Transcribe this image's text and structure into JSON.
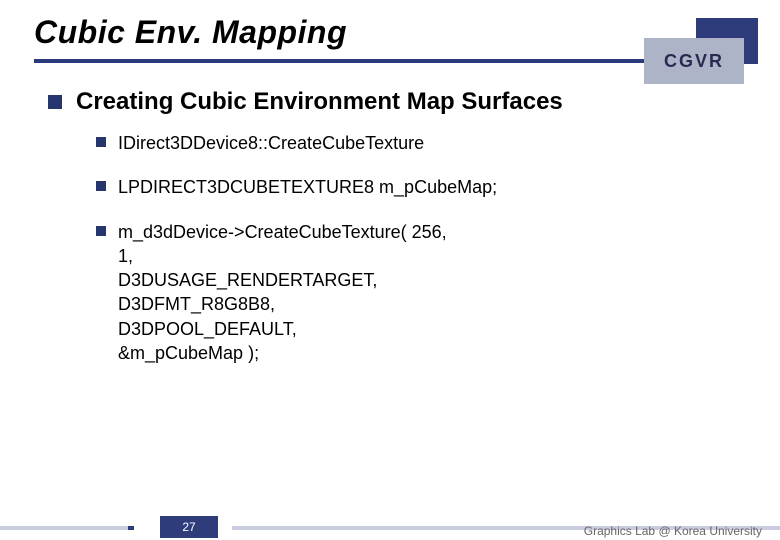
{
  "title": "Cubic Env. Mapping",
  "badge": {
    "label": "CGVR"
  },
  "heading": "Creating Cubic Environment Map Surfaces",
  "subitems": [
    "IDirect3DDevice8::CreateCubeTexture",
    "LPDIRECT3DCUBETEXTURE8 m_pCubeMap;",
    "m_d3dDevice->CreateCubeTexture( 256,\n          1,\n          D3DUSAGE_RENDERTARGET,\n          D3DFMT_R8G8B8,\n          D3DPOOL_DEFAULT,\n          &m_pCubeMap );"
  ],
  "footer": {
    "page": "27",
    "attrib": "Graphics Lab @ Korea University"
  }
}
